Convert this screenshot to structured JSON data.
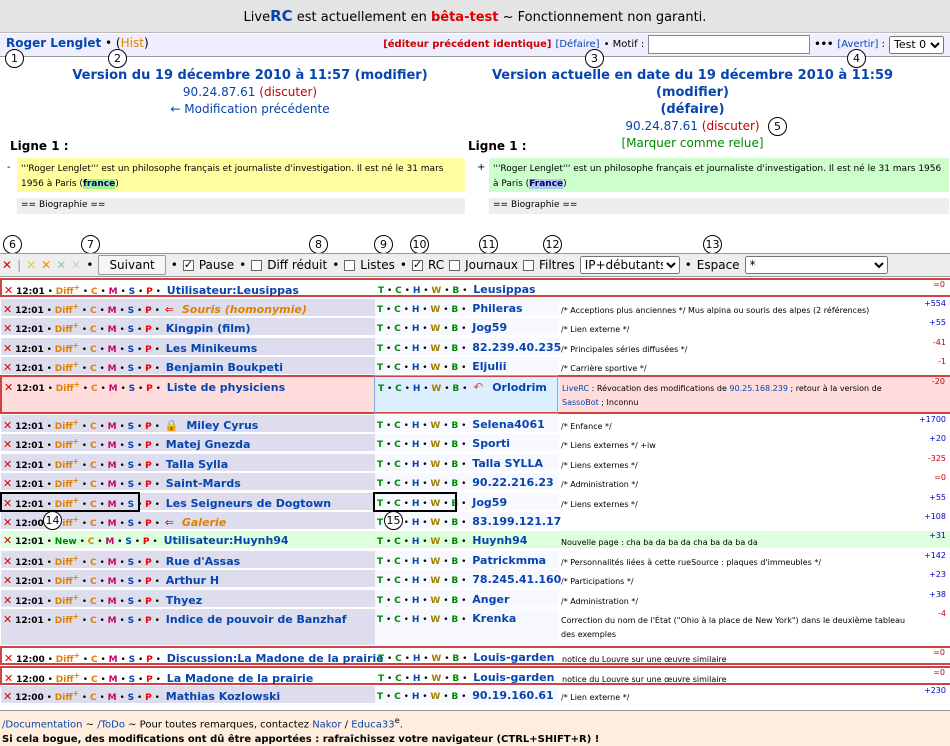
{
  "banner": {
    "prefix": "Live",
    "rc": "RC",
    "text1": " est actuellement en ",
    "beta": "bêta-test",
    "text2": " ~ Fonctionnement non garanti."
  },
  "header": {
    "user": "Roger Lenglet",
    "sep": " • (",
    "hist": "Hist",
    "close": ")",
    "same": "[éditeur précédent identique]",
    "undo": "[Défaire]",
    "motif": "• Motif :",
    "motif_value": "",
    "dots": "•••",
    "warn": "[Avertir]",
    "warn_sep": " :",
    "test_select": "Test 0"
  },
  "left_version": {
    "title": "Version du 19 décembre 2010 à 11:57 (modifier)",
    "ip": "90.24.87.61",
    "discuss": "(discuter)",
    "prev": "← Modification précédente"
  },
  "right_version": {
    "title1": "Version actuelle en date du 19 décembre 2010 à 11:59 (modifier)",
    "title2": "(défaire)",
    "ip": "90.24.87.61",
    "discuss": "(discuter)",
    "reviewed": "[Marquer comme relue]"
  },
  "ligne_left": "Ligne 1 :",
  "ligne_right": "Ligne 1 :",
  "diff_left": {
    "marker": "-",
    "before": "'''Roger Lenglet''' est un philosophe français et journaliste d'investigation. Il est né le 31 mars 1956 à Paris (",
    "hl": "france",
    "after": ")"
  },
  "diff_right": {
    "marker": "+",
    "before": "'''Roger Lenglet''' est un philosophe français et journaliste d'investigation. Il est né le 31 mars 1956 à Paris (",
    "hl": "France",
    "after": ")"
  },
  "context": "== Biographie ==",
  "numbers": [
    "1",
    "2",
    "3",
    "4",
    "5",
    "6",
    "7",
    "8",
    "9",
    "10",
    "11",
    "12",
    "13",
    "14",
    "15"
  ],
  "toolbar": {
    "next": "Suivant",
    "pause": "Pause",
    "diff_reduced": "Diff réduit",
    "lists": "Listes",
    "rc": "RC",
    "logs": "Journaux",
    "filters": "Filtres",
    "select": "IP+débutants",
    "space_label": "Espace",
    "space_value": "*"
  },
  "rows": [
    {
      "time": "12:01",
      "diff": "Diff",
      "title": "Utilisateur:Leusippas",
      "user": "Leusippas",
      "comment": "",
      "size": "=0",
      "sign": "zero"
    },
    {
      "time": "12:01",
      "diff": "Diff",
      "title": "Souris (homonymie)",
      "orange": true,
      "flag": true,
      "user": "Phileras",
      "comment": "/* Acceptions plus anciennes */ Mus alpina ou souris des alpes (2 références)",
      "size": "+554",
      "sign": "pos"
    },
    {
      "time": "12:01",
      "diff": "Diff",
      "title": "Kingpin (film)",
      "user": "Jog59",
      "comment": "/* Lien externe */",
      "size": "+55",
      "sign": "pos"
    },
    {
      "time": "12:01",
      "diff": "Diff",
      "title": "Les Minikeums",
      "user": "82.239.40.235",
      "comment": "/* Principales séries diffusées */",
      "size": "-41",
      "sign": "neg"
    },
    {
      "time": "12:01",
      "diff": "Diff",
      "title": "Benjamin Boukpeti",
      "user": "Eljulii",
      "comment": "/* Carrière sportive */",
      "size": "-1",
      "sign": "neg"
    },
    {
      "time": "12:01",
      "diff": "Diff",
      "title": "Liste de physiciens",
      "user": "Orlodrim",
      "revert": true,
      "comment_liverc": "LiveRC",
      "comment1": " : Révocation des modifications de ",
      "comment_ip": "90.25.168.239",
      "comment2": " ; retour à la version de ",
      "comment_bot": "SassoBot",
      "comment3": " ; Inconnu",
      "size": "-20",
      "sign": "neg"
    },
    {
      "time": "12:01",
      "diff": "Diff",
      "title": "Miley Cyrus",
      "lock": true,
      "user": "Selena4061",
      "comment": "/* Enfance */",
      "size": "+1700",
      "sign": "pos"
    },
    {
      "time": "12:01",
      "diff": "Diff",
      "title": "Matej Gnezda",
      "user": "Sporti",
      "comment": "/* Liens externes */ +iw",
      "size": "+20",
      "sign": "pos"
    },
    {
      "time": "12:01",
      "diff": "Diff",
      "title": "Talla Sylla",
      "user": "Talla SYLLA",
      "comment": "/* Liens externes */",
      "size": "-325",
      "sign": "neg"
    },
    {
      "time": "12:01",
      "diff": "Diff",
      "title": "Saint-Mards",
      "user": "90.22.216.23",
      "comment": "/* Administration */",
      "size": "=0",
      "sign": "zero"
    },
    {
      "time": "12:01",
      "diff": "Diff",
      "title": "Les Seigneurs de Dogtown",
      "user": "Jog59",
      "comment": "/* Liens externes */",
      "size": "+55",
      "sign": "pos"
    },
    {
      "time": "12:00",
      "diff": "Diff",
      "title": "Galerie",
      "orange": true,
      "flag": true,
      "user": "83.199.121.17",
      "comment": "",
      "size": "+108",
      "sign": "pos"
    },
    {
      "time": "12:01",
      "new": "New",
      "title": "Utilisateur:Huynh94",
      "user": "Huynh94",
      "comment": "Nouvelle page : cha ba da ba da cha ba da ba da",
      "size": "+31",
      "sign": "pos"
    },
    {
      "time": "12:01",
      "diff": "Diff",
      "title": "Rue d'Assas",
      "user": "Patrickmma",
      "comment": "/* Personnalités liées à cette rueSource : plaques d'immeubles */",
      "size": "+142",
      "sign": "pos"
    },
    {
      "time": "12:01",
      "diff": "Diff",
      "title": "Arthur H",
      "user": "78.245.41.160",
      "comment": "/* Participations */",
      "size": "+23",
      "sign": "pos"
    },
    {
      "time": "12:01",
      "diff": "Diff",
      "title": "Thyez",
      "user": "Anger",
      "comment": "/* Administration */",
      "size": "+38",
      "sign": "pos"
    },
    {
      "time": "12:01",
      "diff": "Diff",
      "title": "Indice de pouvoir de Banzhaf",
      "user": "Krenka",
      "comment": "Correction du nom de l'État (\"Ohio à la place de New York\") dans le deuxième tableau des exemples",
      "size": "-4",
      "sign": "neg"
    },
    {
      "time": "12:00",
      "diff": "Diff",
      "title": "Discussion:La Madone de la prairie",
      "user": "Louis-garden",
      "comment": "notice du Louvre sur une œuvre similaire",
      "size": "=0",
      "sign": "zero"
    },
    {
      "time": "12:00",
      "diff": "Diff",
      "title": "La Madone de la prairie",
      "user": "Louis-garden",
      "comment": "notice du Louvre sur une œuvre similaire",
      "size": "=0",
      "sign": "zero"
    },
    {
      "time": "12:00",
      "diff": "Diff",
      "title": "Mathias Kozlowski",
      "user": "90.19.160.61",
      "comment": "/* Lien externe */",
      "size": "+230",
      "sign": "pos"
    }
  ],
  "row_links": {
    "plus": "+",
    "C": "C",
    "M": "M",
    "S": "P",
    "Sx": "S",
    "T": "T",
    "Cc": "C",
    "H": "H",
    "W": "W",
    "B": "B",
    "bullet": "•"
  },
  "footer": {
    "doc": "/Documentation",
    "sep1": " ~ ",
    "todo": "/ToDo",
    "text1": " ~ Pour toutes remarques, contactez ",
    "nakor": "Nakor",
    "sep2": " / ",
    "educa": "Educa33",
    "sup": "e",
    "dot": ".",
    "line2": "Si cela bogue, des modifications ont dû être apportées : rafraîchissez votre navigateur (CTRL+SHIFT+R) !"
  }
}
